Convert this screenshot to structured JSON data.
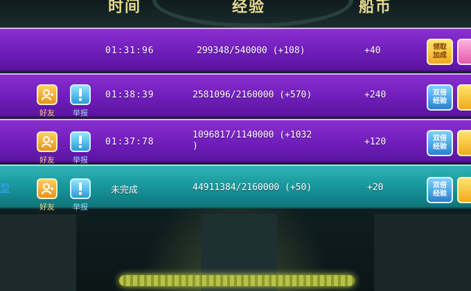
{
  "header": {
    "col_time": "时间",
    "col_exp": "经验",
    "col_gold": "船币"
  },
  "rows": [
    {
      "time": "01:31:96",
      "exp": "299348/540000 (+108)",
      "gold": "+40",
      "button_primary": "领取\n加成",
      "has_badges": false
    },
    {
      "time": "01:38:39",
      "exp": "2581096/2160000 (+570)",
      "gold": "+240",
      "button_primary": "双倍\n经验",
      "friend_label": "好友",
      "report_label": "举报",
      "has_badges": true
    },
    {
      "time": "01:37:78",
      "exp_line1": "1096817/1140000 (+1032",
      "exp_line2": ")",
      "gold": "+120",
      "button_primary": "双倍\n经验",
      "friend_label": "好友",
      "report_label": "举报",
      "has_badges": true
    },
    {
      "time": "未完成",
      "exp": "44911384/2160000 (+50)",
      "gold": "+20",
      "button_primary": "双倍\n经验",
      "friend_label": "好友",
      "report_label": "举报",
      "left_link": "型",
      "has_badges": true
    }
  ],
  "colors": {
    "purple_row": "#7420bf",
    "teal_row": "#17969b",
    "header_text": "#e8d890",
    "friend_badge": "#e8931c",
    "report_badge": "#2c9ad6"
  },
  "icons": {
    "friend": "add-friend-icon",
    "report": "exclamation-icon"
  }
}
